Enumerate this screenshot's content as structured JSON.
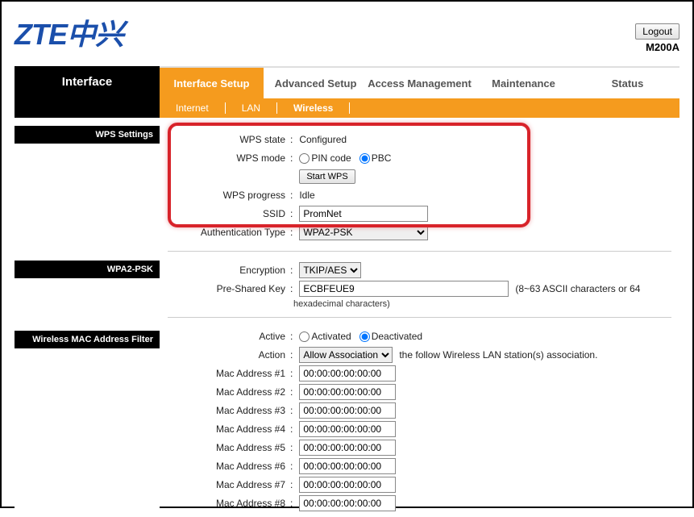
{
  "header": {
    "logo": "ZTE中兴",
    "logout": "Logout",
    "model": "M200A"
  },
  "nav": {
    "title": "Interface",
    "tabs": [
      "Interface Setup",
      "Advanced Setup",
      "Access Management",
      "Maintenance",
      "Status"
    ],
    "subtabs": [
      "Internet",
      "LAN",
      "Wireless"
    ]
  },
  "sections": {
    "wps": "WPS Settings",
    "wpa": "WPA2-PSK",
    "mac": "Wireless MAC Address Filter"
  },
  "wps": {
    "state_label": "WPS state",
    "state_val": "Configured",
    "mode_label": "WPS mode",
    "mode_pin": "PIN code",
    "mode_pbc": "PBC",
    "start_btn": "Start WPS",
    "progress_label": "WPS progress",
    "progress_val": "Idle",
    "ssid_label": "SSID",
    "ssid_val": "PromNet",
    "auth_label": "Authentication Type",
    "auth_val": "WPA2-PSK"
  },
  "wpa": {
    "enc_label": "Encryption",
    "enc_val": "TKIP/AES",
    "psk_label": "Pre-Shared Key",
    "psk_val": "ECBFEUE9",
    "psk_hint1": "(8~63 ASCII characters or 64",
    "psk_hint2": "hexadecimal characters)"
  },
  "mac": {
    "active_label": "Active",
    "active_on": "Activated",
    "active_off": "Deactivated",
    "action_label": "Action",
    "action_val": "Allow Association",
    "action_hint": "the follow Wireless LAN station(s) association.",
    "rows": [
      {
        "label": "Mac Address #1",
        "val": "00:00:00:00:00:00"
      },
      {
        "label": "Mac Address #2",
        "val": "00:00:00:00:00:00"
      },
      {
        "label": "Mac Address #3",
        "val": "00:00:00:00:00:00"
      },
      {
        "label": "Mac Address #4",
        "val": "00:00:00:00:00:00"
      },
      {
        "label": "Mac Address #5",
        "val": "00:00:00:00:00:00"
      },
      {
        "label": "Mac Address #6",
        "val": "00:00:00:00:00:00"
      },
      {
        "label": "Mac Address #7",
        "val": "00:00:00:00:00:00"
      },
      {
        "label": "Mac Address #8",
        "val": "00:00:00:00:00:00"
      }
    ]
  }
}
